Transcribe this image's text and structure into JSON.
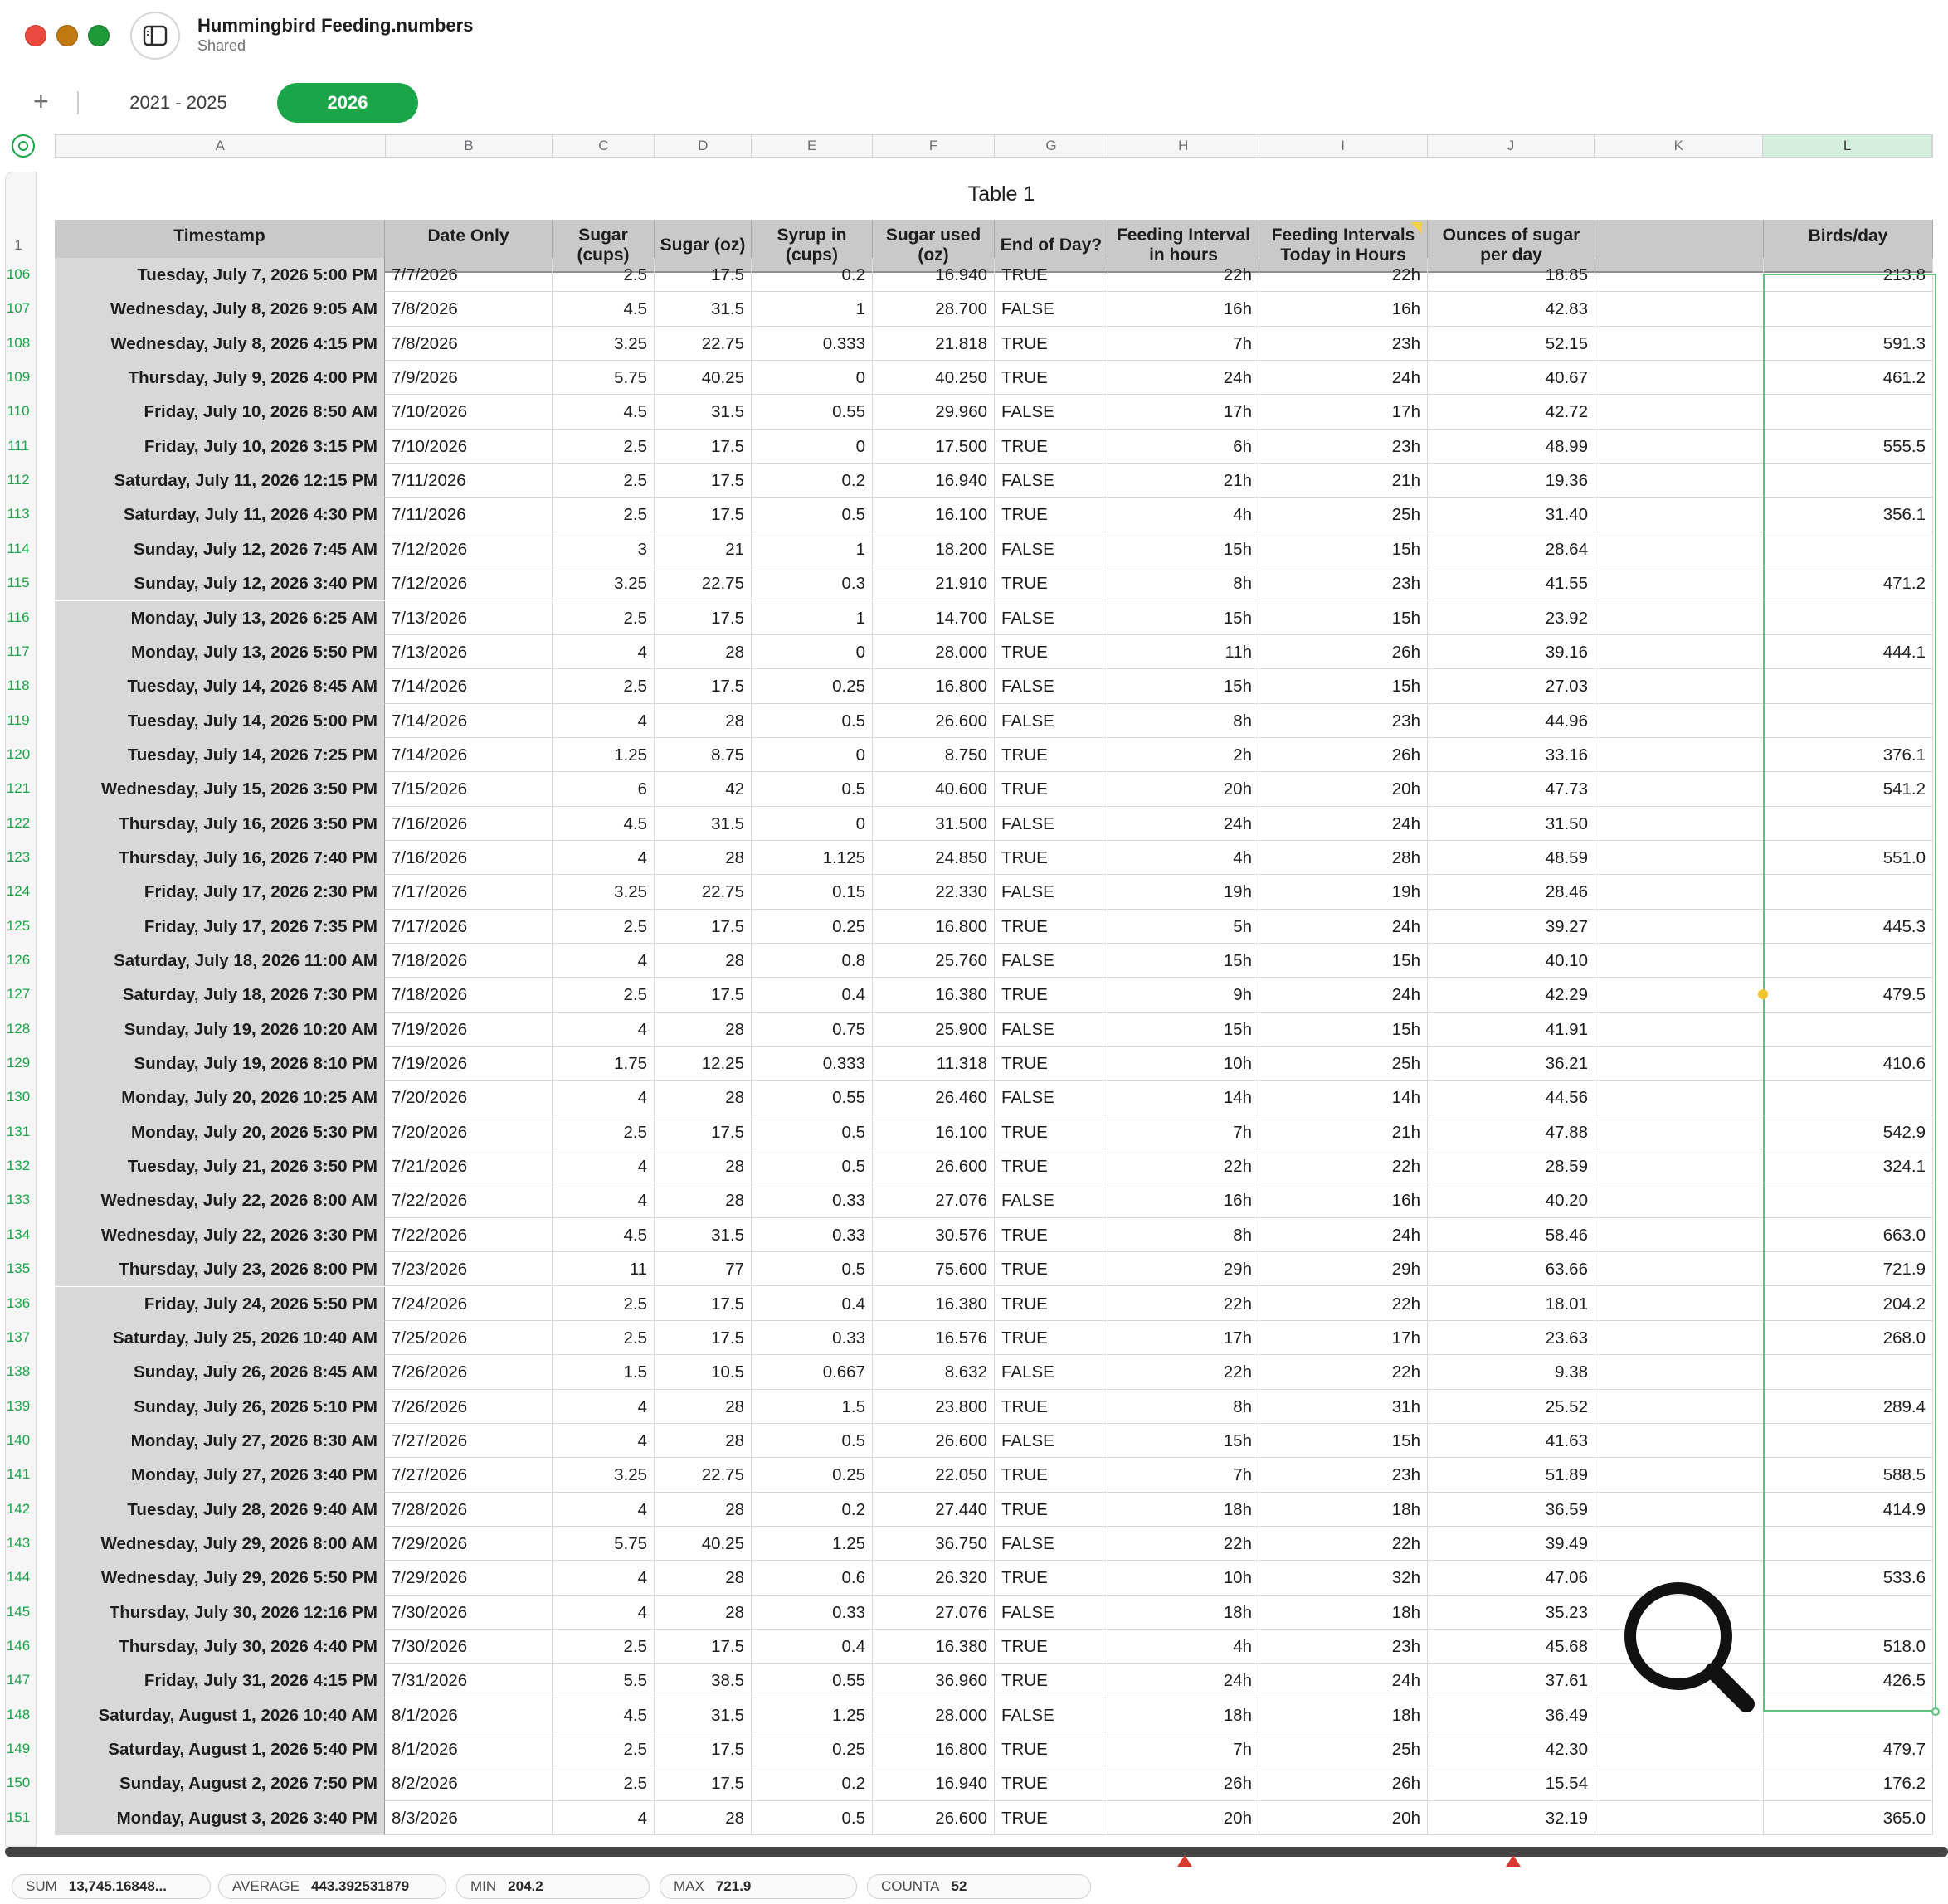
{
  "window": {
    "title": "Hummingbird Feeding.numbers",
    "subtitle": "Shared"
  },
  "toolbar": {
    "add_sheet": "+"
  },
  "sheets": [
    {
      "label": "2021 - 2025",
      "active": false
    },
    {
      "label": "2026",
      "active": true
    }
  ],
  "columns": [
    "A",
    "B",
    "C",
    "D",
    "E",
    "F",
    "G",
    "H",
    "I",
    "J",
    "K",
    "L"
  ],
  "selected_column": "L",
  "table": {
    "title": "Table 1",
    "header_row_number": "1",
    "headers": [
      "Timestamp",
      "Date Only",
      "Sugar\n(cups)",
      "Sugar (oz)",
      "Syrup in\n(cups)",
      "Sugar used\n(oz)",
      "End of Day?",
      "Feeding Interval\nin hours",
      "Feeding Intervals\nToday in Hours",
      "Ounces of sugar\nper day",
      "",
      "Birds/day"
    ],
    "rows": [
      [
        "106",
        "Tuesday, July 7, 2026 5:00 PM",
        "7/7/2026",
        "2.5",
        "17.5",
        "0.2",
        "16.940",
        "TRUE",
        "22h",
        "22h",
        "18.85",
        "",
        "213.8"
      ],
      [
        "107",
        "Wednesday, July 8, 2026 9:05 AM",
        "7/8/2026",
        "4.5",
        "31.5",
        "1",
        "28.700",
        "FALSE",
        "16h",
        "16h",
        "42.83",
        "",
        ""
      ],
      [
        "108",
        "Wednesday, July 8, 2026 4:15 PM",
        "7/8/2026",
        "3.25",
        "22.75",
        "0.333",
        "21.818",
        "TRUE",
        "7h",
        "23h",
        "52.15",
        "",
        "591.3"
      ],
      [
        "109",
        "Thursday, July 9, 2026 4:00 PM",
        "7/9/2026",
        "5.75",
        "40.25",
        "0",
        "40.250",
        "TRUE",
        "24h",
        "24h",
        "40.67",
        "",
        "461.2"
      ],
      [
        "110",
        "Friday, July 10, 2026 8:50 AM",
        "7/10/2026",
        "4.5",
        "31.5",
        "0.55",
        "29.960",
        "FALSE",
        "17h",
        "17h",
        "42.72",
        "",
        ""
      ],
      [
        "111",
        "Friday, July 10, 2026 3:15 PM",
        "7/10/2026",
        "2.5",
        "17.5",
        "0",
        "17.500",
        "TRUE",
        "6h",
        "23h",
        "48.99",
        "",
        "555.5"
      ],
      [
        "112",
        "Saturday, July 11, 2026 12:15 PM",
        "7/11/2026",
        "2.5",
        "17.5",
        "0.2",
        "16.940",
        "FALSE",
        "21h",
        "21h",
        "19.36",
        "",
        ""
      ],
      [
        "113",
        "Saturday, July 11, 2026 4:30 PM",
        "7/11/2026",
        "2.5",
        "17.5",
        "0.5",
        "16.100",
        "TRUE",
        "4h",
        "25h",
        "31.40",
        "",
        "356.1"
      ],
      [
        "114",
        "Sunday, July 12, 2026 7:45 AM",
        "7/12/2026",
        "3",
        "21",
        "1",
        "18.200",
        "FALSE",
        "15h",
        "15h",
        "28.64",
        "",
        ""
      ],
      [
        "115",
        "Sunday, July 12, 2026 3:40 PM",
        "7/12/2026",
        "3.25",
        "22.75",
        "0.3",
        "21.910",
        "TRUE",
        "8h",
        "23h",
        "41.55",
        "",
        "471.2"
      ],
      [
        "116",
        "Monday, July 13, 2026 6:25 AM",
        "7/13/2026",
        "2.5",
        "17.5",
        "1",
        "14.700",
        "FALSE",
        "15h",
        "15h",
        "23.92",
        "",
        ""
      ],
      [
        "117",
        "Monday, July 13, 2026 5:50 PM",
        "7/13/2026",
        "4",
        "28",
        "0",
        "28.000",
        "TRUE",
        "11h",
        "26h",
        "39.16",
        "",
        "444.1"
      ],
      [
        "118",
        "Tuesday, July 14, 2026 8:45 AM",
        "7/14/2026",
        "2.5",
        "17.5",
        "0.25",
        "16.800",
        "FALSE",
        "15h",
        "15h",
        "27.03",
        "",
        ""
      ],
      [
        "119",
        "Tuesday, July 14, 2026 5:00 PM",
        "7/14/2026",
        "4",
        "28",
        "0.5",
        "26.600",
        "FALSE",
        "8h",
        "23h",
        "44.96",
        "",
        ""
      ],
      [
        "120",
        "Tuesday, July 14, 2026 7:25 PM",
        "7/14/2026",
        "1.25",
        "8.75",
        "0",
        "8.750",
        "TRUE",
        "2h",
        "26h",
        "33.16",
        "",
        "376.1"
      ],
      [
        "121",
        "Wednesday, July 15, 2026 3:50 PM",
        "7/15/2026",
        "6",
        "42",
        "0.5",
        "40.600",
        "TRUE",
        "20h",
        "20h",
        "47.73",
        "",
        "541.2"
      ],
      [
        "122",
        "Thursday, July 16, 2026 3:50 PM",
        "7/16/2026",
        "4.5",
        "31.5",
        "0",
        "31.500",
        "FALSE",
        "24h",
        "24h",
        "31.50",
        "",
        ""
      ],
      [
        "123",
        "Thursday, July 16, 2026 7:40 PM",
        "7/16/2026",
        "4",
        "28",
        "1.125",
        "24.850",
        "TRUE",
        "4h",
        "28h",
        "48.59",
        "",
        "551.0"
      ],
      [
        "124",
        "Friday, July 17, 2026 2:30 PM",
        "7/17/2026",
        "3.25",
        "22.75",
        "0.15",
        "22.330",
        "FALSE",
        "19h",
        "19h",
        "28.46",
        "",
        ""
      ],
      [
        "125",
        "Friday, July 17, 2026 7:35 PM",
        "7/17/2026",
        "2.5",
        "17.5",
        "0.25",
        "16.800",
        "TRUE",
        "5h",
        "24h",
        "39.27",
        "",
        "445.3"
      ],
      [
        "126",
        "Saturday, July 18, 2026 11:00 AM",
        "7/18/2026",
        "4",
        "28",
        "0.8",
        "25.760",
        "FALSE",
        "15h",
        "15h",
        "40.10",
        "",
        ""
      ],
      [
        "127",
        "Saturday, July 18, 2026 7:30 PM",
        "7/18/2026",
        "2.5",
        "17.5",
        "0.4",
        "16.380",
        "TRUE",
        "9h",
        "24h",
        "42.29",
        "",
        "479.5"
      ],
      [
        "128",
        "Sunday, July 19, 2026 10:20 AM",
        "7/19/2026",
        "4",
        "28",
        "0.75",
        "25.900",
        "FALSE",
        "15h",
        "15h",
        "41.91",
        "",
        ""
      ],
      [
        "129",
        "Sunday, July 19, 2026 8:10 PM",
        "7/19/2026",
        "1.75",
        "12.25",
        "0.333",
        "11.318",
        "TRUE",
        "10h",
        "25h",
        "36.21",
        "",
        "410.6"
      ],
      [
        "130",
        "Monday, July 20, 2026 10:25 AM",
        "7/20/2026",
        "4",
        "28",
        "0.55",
        "26.460",
        "FALSE",
        "14h",
        "14h",
        "44.56",
        "",
        ""
      ],
      [
        "131",
        "Monday, July 20, 2026 5:30 PM",
        "7/20/2026",
        "2.5",
        "17.5",
        "0.5",
        "16.100",
        "TRUE",
        "7h",
        "21h",
        "47.88",
        "",
        "542.9"
      ],
      [
        "132",
        "Tuesday, July 21, 2026 3:50 PM",
        "7/21/2026",
        "4",
        "28",
        "0.5",
        "26.600",
        "TRUE",
        "22h",
        "22h",
        "28.59",
        "",
        "324.1"
      ],
      [
        "133",
        "Wednesday, July 22, 2026 8:00 AM",
        "7/22/2026",
        "4",
        "28",
        "0.33",
        "27.076",
        "FALSE",
        "16h",
        "16h",
        "40.20",
        "",
        ""
      ],
      [
        "134",
        "Wednesday, July 22, 2026 3:30 PM",
        "7/22/2026",
        "4.5",
        "31.5",
        "0.33",
        "30.576",
        "TRUE",
        "8h",
        "24h",
        "58.46",
        "",
        "663.0"
      ],
      [
        "135",
        "Thursday, July 23, 2026 8:00 PM",
        "7/23/2026",
        "11",
        "77",
        "0.5",
        "75.600",
        "TRUE",
        "29h",
        "29h",
        "63.66",
        "",
        "721.9"
      ],
      [
        "136",
        "Friday, July 24, 2026 5:50 PM",
        "7/24/2026",
        "2.5",
        "17.5",
        "0.4",
        "16.380",
        "TRUE",
        "22h",
        "22h",
        "18.01",
        "",
        "204.2"
      ],
      [
        "137",
        "Saturday, July 25, 2026 10:40 AM",
        "7/25/2026",
        "2.5",
        "17.5",
        "0.33",
        "16.576",
        "TRUE",
        "17h",
        "17h",
        "23.63",
        "",
        "268.0"
      ],
      [
        "138",
        "Sunday, July 26, 2026 8:45 AM",
        "7/26/2026",
        "1.5",
        "10.5",
        "0.667",
        "8.632",
        "FALSE",
        "22h",
        "22h",
        "9.38",
        "",
        ""
      ],
      [
        "139",
        "Sunday, July 26, 2026 5:10 PM",
        "7/26/2026",
        "4",
        "28",
        "1.5",
        "23.800",
        "TRUE",
        "8h",
        "31h",
        "25.52",
        "",
        "289.4"
      ],
      [
        "140",
        "Monday, July 27, 2026 8:30 AM",
        "7/27/2026",
        "4",
        "28",
        "0.5",
        "26.600",
        "FALSE",
        "15h",
        "15h",
        "41.63",
        "",
        ""
      ],
      [
        "141",
        "Monday, July 27, 2026 3:40 PM",
        "7/27/2026",
        "3.25",
        "22.75",
        "0.25",
        "22.050",
        "TRUE",
        "7h",
        "23h",
        "51.89",
        "",
        "588.5"
      ],
      [
        "142",
        "Tuesday, July 28, 2026 9:40 AM",
        "7/28/2026",
        "4",
        "28",
        "0.2",
        "27.440",
        "TRUE",
        "18h",
        "18h",
        "36.59",
        "",
        "414.9"
      ],
      [
        "143",
        "Wednesday, July 29, 2026 8:00 AM",
        "7/29/2026",
        "5.75",
        "40.25",
        "1.25",
        "36.750",
        "FALSE",
        "22h",
        "22h",
        "39.49",
        "",
        ""
      ],
      [
        "144",
        "Wednesday, July 29, 2026 5:50 PM",
        "7/29/2026",
        "4",
        "28",
        "0.6",
        "26.320",
        "TRUE",
        "10h",
        "32h",
        "47.06",
        "",
        "533.6"
      ],
      [
        "145",
        "Thursday, July 30, 2026 12:16 PM",
        "7/30/2026",
        "4",
        "28",
        "0.33",
        "27.076",
        "FALSE",
        "18h",
        "18h",
        "35.23",
        "",
        ""
      ],
      [
        "146",
        "Thursday, July 30, 2026 4:40 PM",
        "7/30/2026",
        "2.5",
        "17.5",
        "0.4",
        "16.380",
        "TRUE",
        "4h",
        "23h",
        "45.68",
        "",
        "518.0"
      ],
      [
        "147",
        "Friday, July 31, 2026 4:15 PM",
        "7/31/2026",
        "5.5",
        "38.5",
        "0.55",
        "36.960",
        "TRUE",
        "24h",
        "24h",
        "37.61",
        "",
        "426.5"
      ],
      [
        "148",
        "Saturday, August 1, 2026 10:40 AM",
        "8/1/2026",
        "4.5",
        "31.5",
        "1.25",
        "28.000",
        "FALSE",
        "18h",
        "18h",
        "36.49",
        "",
        ""
      ],
      [
        "149",
        "Saturday, August 1, 2026 5:40 PM",
        "8/1/2026",
        "2.5",
        "17.5",
        "0.25",
        "16.800",
        "TRUE",
        "7h",
        "25h",
        "42.30",
        "",
        "479.7"
      ],
      [
        "150",
        "Sunday, August 2, 2026 7:50 PM",
        "8/2/2026",
        "2.5",
        "17.5",
        "0.2",
        "16.940",
        "TRUE",
        "26h",
        "26h",
        "15.54",
        "",
        "176.2"
      ],
      [
        "151",
        "Monday, August 3, 2026 3:40 PM",
        "8/3/2026",
        "4",
        "28",
        "0.5",
        "26.600",
        "TRUE",
        "20h",
        "20h",
        "32.19",
        "",
        "365.0"
      ]
    ]
  },
  "status_bar": [
    {
      "key": "SUM",
      "value": "13,745.16848..."
    },
    {
      "key": "AVERAGE",
      "value": "443.392531879"
    },
    {
      "key": "MIN",
      "value": "204.2"
    },
    {
      "key": "MAX",
      "value": "721.9"
    },
    {
      "key": "COUNTA",
      "value": "52"
    }
  ],
  "icons": {
    "sidebar": "sidebar-toggle-icon",
    "zoom": "magnifying-glass-icon",
    "warning": "warning-triangle-icon"
  },
  "colors": {
    "accent_green": "#1aa548",
    "header_gray": "#c9c9c9",
    "close": "#ed4a3f",
    "minimize": "#c07a10",
    "maximize": "#1f9a3a"
  }
}
